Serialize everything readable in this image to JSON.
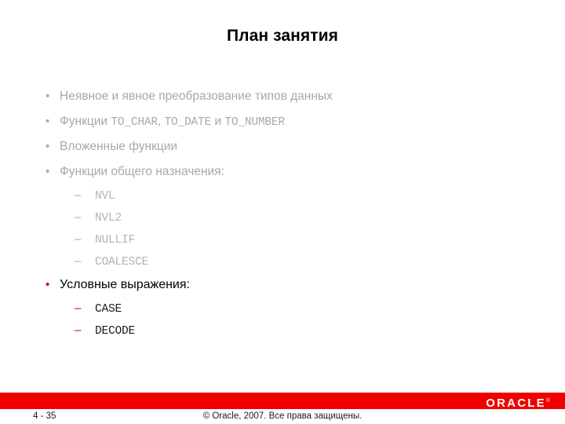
{
  "slide": {
    "title": "План занятия",
    "background_color": "#ffffff",
    "accent_color": "#cc0000",
    "muted_color": "#a8a8a8",
    "bar_color": "#f20000"
  },
  "outline": [
    {
      "level": 1,
      "marker": "•",
      "marker_style": "muted",
      "style": "muted",
      "segments": [
        {
          "text": "Неявное и явное преобразование типов данных",
          "font": "sans"
        }
      ]
    },
    {
      "level": 1,
      "marker": "•",
      "marker_style": "muted",
      "style": "muted",
      "segments": [
        {
          "text": "Функции ",
          "font": "sans"
        },
        {
          "text": "TO_CHAR",
          "font": "mono"
        },
        {
          "text": ", ",
          "font": "sans"
        },
        {
          "text": "TO_DATE",
          "font": "mono"
        },
        {
          "text": " и ",
          "font": "sans"
        },
        {
          "text": "TO_NUMBER",
          "font": "mono"
        }
      ]
    },
    {
      "level": 1,
      "marker": "•",
      "marker_style": "muted",
      "style": "muted",
      "segments": [
        {
          "text": "Вложенные функции",
          "font": "sans"
        }
      ]
    },
    {
      "level": 1,
      "marker": "•",
      "marker_style": "muted",
      "style": "muted",
      "segments": [
        {
          "text": "Функции общего назначения:",
          "font": "sans"
        }
      ]
    },
    {
      "level": 2,
      "marker": "–",
      "marker_style": "muted",
      "style": "code-muted",
      "segments": [
        {
          "text": "NVL",
          "font": "mono"
        }
      ]
    },
    {
      "level": 2,
      "marker": "–",
      "marker_style": "muted",
      "style": "code-muted",
      "segments": [
        {
          "text": "NVL2",
          "font": "mono"
        }
      ]
    },
    {
      "level": 2,
      "marker": "–",
      "marker_style": "muted",
      "style": "code-muted",
      "segments": [
        {
          "text": "NULLIF",
          "font": "mono"
        }
      ]
    },
    {
      "level": 2,
      "marker": "–",
      "marker_style": "muted",
      "style": "code-muted",
      "segments": [
        {
          "text": "COALESCE",
          "font": "mono"
        }
      ]
    },
    {
      "level": 1,
      "marker": "•",
      "marker_style": "accent",
      "style": "highlight",
      "segments": [
        {
          "text": "Условные выражения:",
          "font": "sans"
        }
      ]
    },
    {
      "level": 2,
      "marker": "–",
      "marker_style": "accent",
      "style": "code-dark",
      "segments": [
        {
          "text": "CASE",
          "font": "mono"
        }
      ]
    },
    {
      "level": 2,
      "marker": "–",
      "marker_style": "accent",
      "style": "code-dark",
      "segments": [
        {
          "text": "DECODE",
          "font": "mono"
        }
      ]
    }
  ],
  "footer": {
    "slide_number": "4 - 35",
    "copyright": "© Oracle, 2007. Все права защищены.",
    "logo_text": "ORACLE",
    "logo_tm": "®"
  }
}
